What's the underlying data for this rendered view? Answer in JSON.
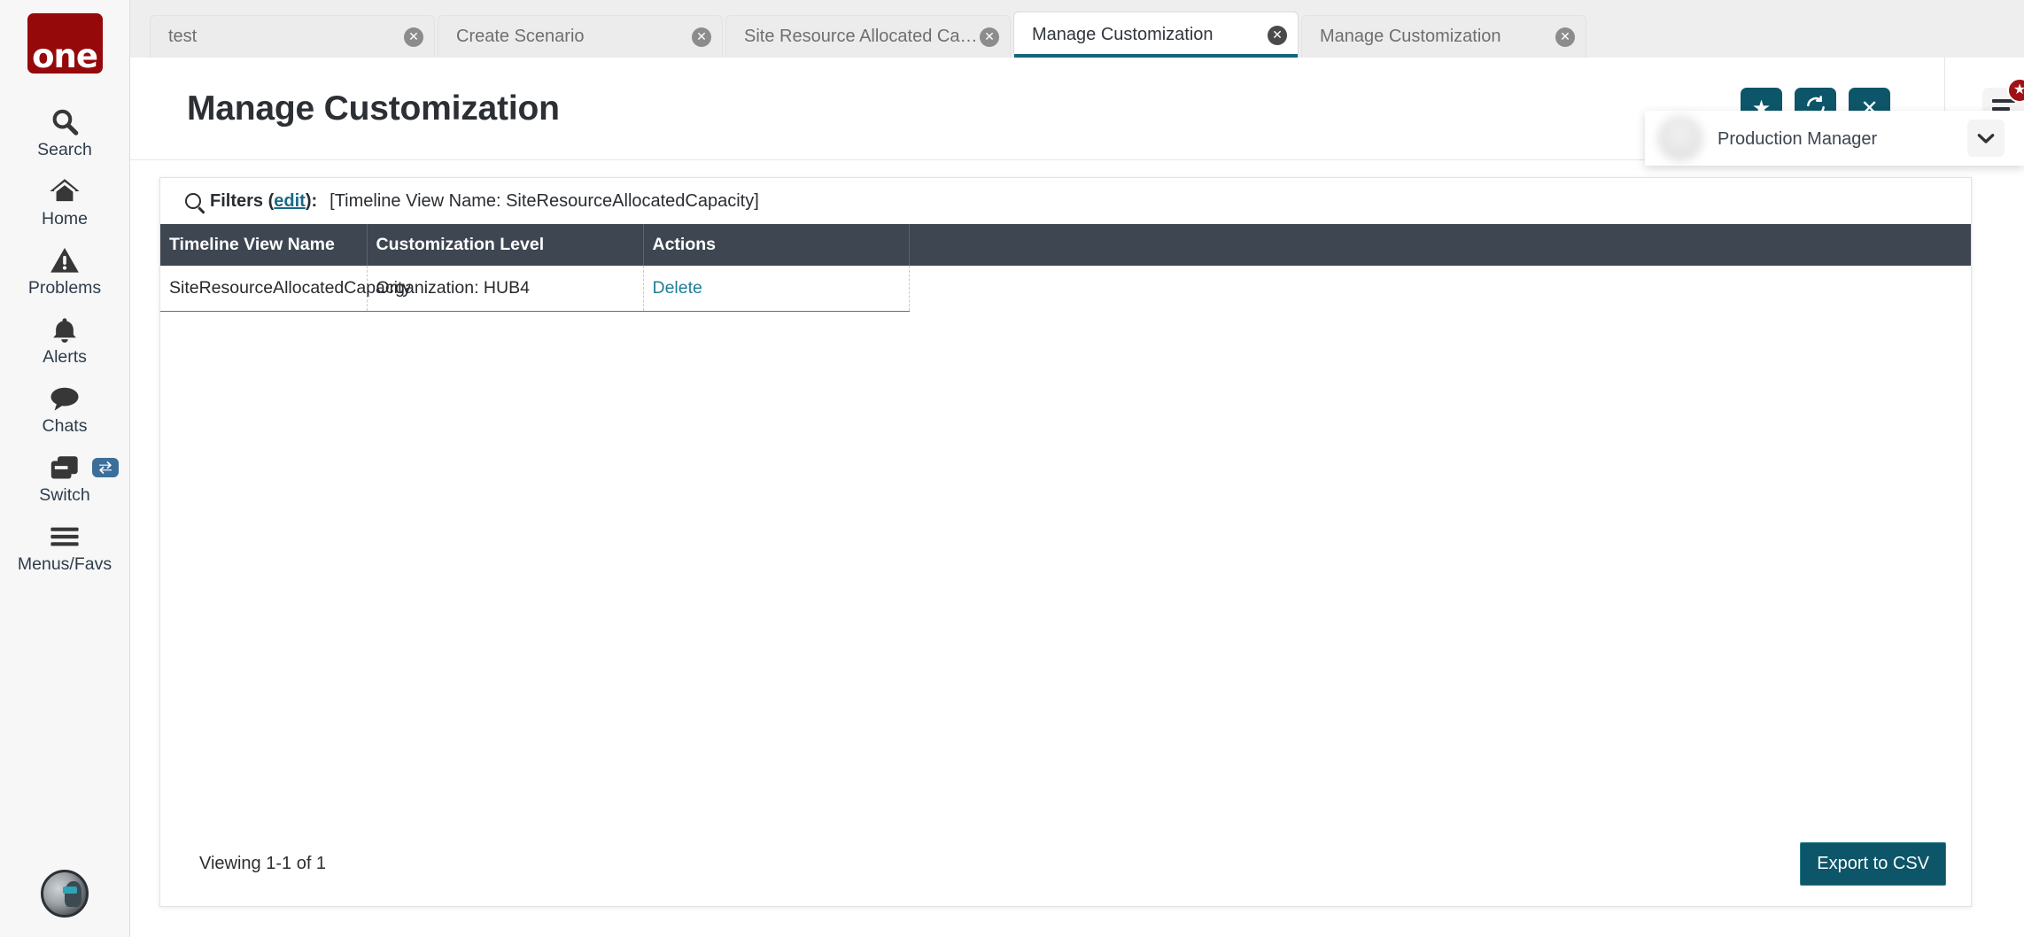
{
  "brand": {
    "logo_text": "one",
    "logo_color": "#96090b",
    "accent_color": "#0d5568",
    "header_row_color": "#3e4651"
  },
  "sidebar": {
    "items": [
      {
        "label": "Search",
        "icon": "search-icon"
      },
      {
        "label": "Home",
        "icon": "home-icon"
      },
      {
        "label": "Problems",
        "icon": "warning-triangle-icon"
      },
      {
        "label": "Alerts",
        "icon": "bell-icon"
      },
      {
        "label": "Chats",
        "icon": "chat-bubble-icon"
      },
      {
        "label": "Switch",
        "icon": "windows-stack-icon",
        "badge_icon": "swap-arrows-icon"
      },
      {
        "label": "Menus/Favs",
        "icon": "hamburger-icon"
      }
    ],
    "avatar_icon": "user-avatar-image"
  },
  "tabs": [
    {
      "label": "test",
      "active": false,
      "close_icon": "close-circle-icon"
    },
    {
      "label": "Create Scenario",
      "active": false,
      "close_icon": "close-circle-icon"
    },
    {
      "label": "Site Resource Allocated Capacity",
      "active": false,
      "close_icon": "close-circle-icon"
    },
    {
      "label": "Manage Customization",
      "active": true,
      "close_icon": "close-circle-icon"
    },
    {
      "label": "Manage Customization",
      "active": false,
      "close_icon": "close-circle-icon"
    }
  ],
  "header": {
    "title": "Manage Customization",
    "buttons": [
      {
        "name": "favorite-button",
        "icon": "star-icon",
        "glyph": "★"
      },
      {
        "name": "refresh-button",
        "icon": "refresh-icon",
        "glyph": "↻"
      },
      {
        "name": "close-button",
        "icon": "close-x-icon",
        "glyph": "✕"
      }
    ],
    "menu_button": {
      "icon": "hamburger-menu-icon",
      "badge_icon": "star-badge-icon",
      "badge_glyph": "★"
    }
  },
  "user": {
    "name": "",
    "role": "Production Manager",
    "org": "",
    "chevron_icon": "chevron-down-icon",
    "chevron_glyph": "❯"
  },
  "filters": {
    "icon": "magnifier-icon",
    "label": "Filters (",
    "edit_label": "edit",
    "label_end": "):",
    "value": "[Timeline View Name: SiteResourceAllocatedCapacity]"
  },
  "table": {
    "columns": [
      "Timeline View Name",
      "Customization Level",
      "Actions",
      ""
    ],
    "rows": [
      {
        "timeline_view_name": "SiteResourceAllocatedCapacity",
        "customization_level": "Organization: HUB4",
        "action_label": "Delete"
      }
    ]
  },
  "footer": {
    "viewing": "Viewing 1-1 of 1",
    "export_label": "Export to CSV"
  }
}
